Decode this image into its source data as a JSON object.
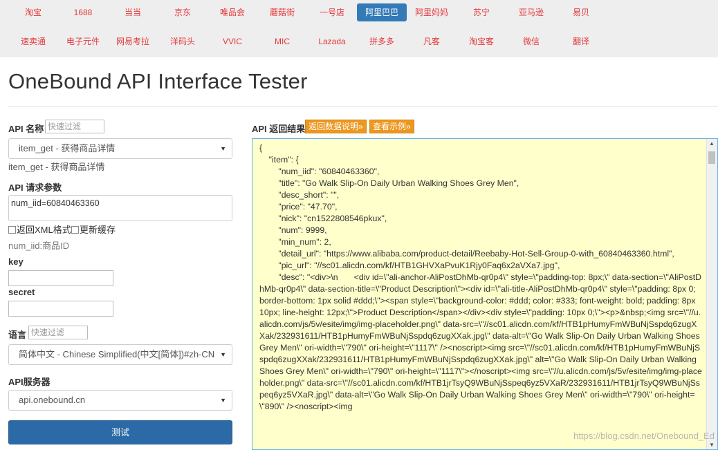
{
  "nav": {
    "row1": [
      "淘宝",
      "1688",
      "当当",
      "京东",
      "唯品会",
      "蘑菇街",
      "一号店",
      "阿里巴巴",
      "阿里妈妈",
      "苏宁",
      "亚马逊",
      "易贝"
    ],
    "row2": [
      "速卖通",
      "电子元件",
      "网易考拉",
      "洋码头",
      "VVIC",
      "MIC",
      "Lazada",
      "拼多多",
      "凡客",
      "淘宝客",
      "微信",
      "翻译"
    ],
    "active": "阿里巴巴"
  },
  "page_title": "OneBound API Interface Tester",
  "left": {
    "api_name_label": "API 名称",
    "api_filter_placeholder": "快速过滤",
    "api_selected": "item_get - 获得商品详情",
    "api_desc": "item_get - 获得商品详情",
    "params_label": "API 请求参数",
    "params_value": "num_iid=60840463360",
    "xml_option": "返回XML格式",
    "cache_option": "更新缓存",
    "param_hint": "num_iid:商品ID",
    "key_label": "key",
    "secret_label": "secret",
    "lang_label": "语言",
    "lang_filter_placeholder": "快速过滤",
    "lang_selected": "简体中文 - Chinese Simplified(中文[简体])#zh-CN",
    "server_label": "API服务器",
    "server_selected": "api.onebound.cn",
    "test_button": "测试"
  },
  "right": {
    "result_label": "API 返回结果",
    "doc_button": "返回数据说明»",
    "example_button": "查看示例»",
    "result_text": "{\n\t\"item\": {\n\t\t\"num_iid\": \"60840463360\",\n\t\t\"title\": \"Go Walk Slip-On Daily Urban Walking Shoes Grey Men\",\n\t\t\"desc_short\": \"\",\n\t\t\"price\": \"47.70\",\n\t\t\"nick\": \"cn1522808546pkux\",\n\t\t\"num\": 9999,\n\t\t\"min_num\": 2,\n\t\t\"detail_url\": \"https://www.alibaba.com/product-detail/Reebaby-Hot-Sell-Group-0-with_60840463360.html\",\n\t\t\"pic_url\": \"//sc01.alicdn.com/kf/HTB1GHVXaPvuK1Rjy0Faq6x2aVXa7.jpg\",\n\t\t\"desc\": \"<div>\\n\t\t<div id=\\\"ali-anchor-AliPostDhMb-qr0p4\\\" style=\\\"padding-top: 8px;\\\" data-section=\\\"AliPostDhMb-qr0p4\\\" data-section-title=\\\"Product Description\\\"><div id=\\\"ali-title-AliPostDhMb-qr0p4\\\" style=\\\"padding: 8px 0; border-bottom: 1px solid #ddd;\\\"><span style=\\\"background-color: #ddd; color: #333; font-weight: bold; padding: 8px 10px; line-height: 12px;\\\">Product Description</span></div><div style=\\\"padding: 10px 0;\\\"><p>&nbsp;<img src=\\\"//u.alicdn.com/js/5v/esite/img/img-placeholder.png\\\" data-src=\\\"//sc01.alicdn.com/kf/HTB1pHumyFmWBuNjSspdq6zugXXak/232931611/HTB1pHumyFmWBuNjSspdq6zugXXak.jpg\\\" data-alt=\\\"Go Walk Slip-On Daily Urban Walking Shoes Grey Men\\\" ori-width=\\\"790\\\" ori-height=\\\"1117\\\" /><noscript><img src=\\\"//sc01.alicdn.com/kf/HTB1pHumyFmWBuNjSspdq6zugXXak/232931611/HTB1pHumyFmWBuNjSspdq6zugXXak.jpg\\\" alt=\\\"Go Walk Slip-On Daily Urban Walking Shoes Grey Men\\\" ori-width=\\\"790\\\" ori-height=\\\"1117\\\"></noscript><img src=\\\"//u.alicdn.com/js/5v/esite/img/img-placeholder.png\\\" data-src=\\\"//sc01.alicdn.com/kf/HTB1jrTsyQ9WBuNjSspeq6yz5VXaR/232931611/HTB1jrTsyQ9WBuNjSspeq6yz5VXaR.jpg\\\" data-alt=\\\"Go Walk Slip-On Daily Urban Walking Shoes Grey Men\\\" ori-width=\\\"790\\\" ori-height=\\\"890\\\" /><noscript><img"
  },
  "watermark": "https://blog.csdn.net/Onebound_Ed",
  "colors": {
    "nav_bg": "#eeeeee",
    "nav_link": "#e4393c",
    "active_tab": "#337ab7",
    "primary_button": "#2b6aa6",
    "orange_button": "#ec971f",
    "result_bg": "#ffffcc"
  }
}
